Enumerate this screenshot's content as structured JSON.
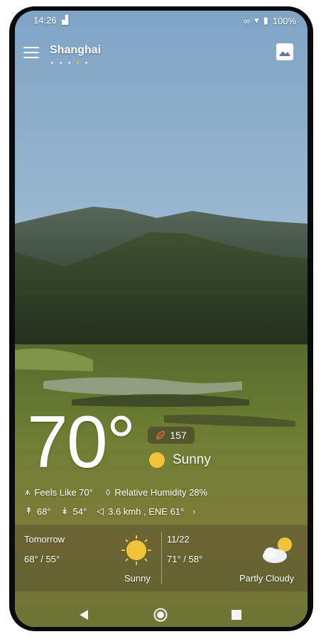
{
  "status_bar": {
    "time": "14:26",
    "battery": "100%"
  },
  "header": {
    "city": "Shanghai",
    "page_dots": 5,
    "active_dot": 4
  },
  "current": {
    "temperature": "70°",
    "aqi": "157",
    "condition": "Sunny",
    "feels_like": "Feels Like 70°",
    "humidity": "Relative Humidity 28%",
    "high": "68°",
    "low": "54°",
    "wind": "3.6 kmh , ENE 61°"
  },
  "forecast": {
    "tomorrow": {
      "label": "Tomorrow",
      "temps": "68° / 55°",
      "condition": "Sunny"
    },
    "next": {
      "label": "11/22",
      "temps": "71° / 58°",
      "condition": "Partly Cloudy"
    }
  },
  "colors": {
    "accent_dot": "#f4c430",
    "sun": "#f2c23a"
  },
  "icons": {
    "menu": "menu-icon",
    "gallery": "image-icon",
    "leaf": "leaf-icon",
    "wind": "wind-icon",
    "humidity": "droplet-icon",
    "sun": "sun-icon",
    "partly_cloudy": "partly-cloudy-icon"
  }
}
